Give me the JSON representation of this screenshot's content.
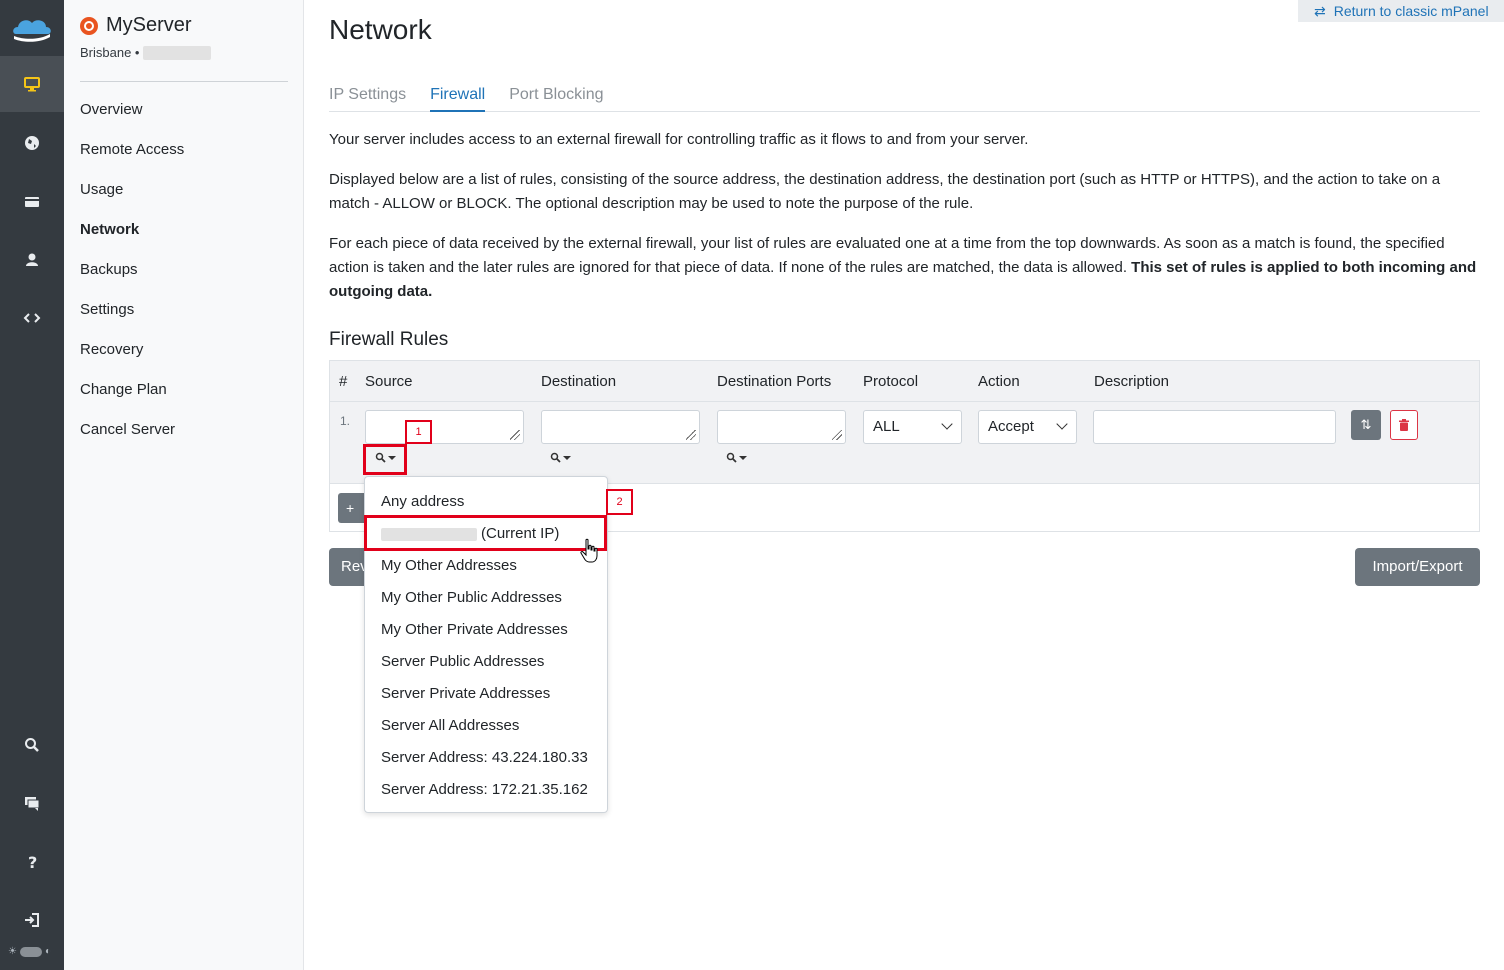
{
  "app": {
    "server_name": "MyServer",
    "location": "Brisbane •",
    "return_link": "Return to classic mPanel"
  },
  "rail": {
    "icons": [
      "cloud-logo-icon",
      "monitor-icon",
      "globe-icon",
      "billing-card-icon",
      "user-icon",
      "code-icon",
      "search-icon",
      "chat-icon",
      "help-icon",
      "logout-icon",
      "theme-toggle-icon"
    ]
  },
  "sidebar": {
    "items": [
      {
        "label": "Overview"
      },
      {
        "label": "Remote Access"
      },
      {
        "label": "Usage"
      },
      {
        "label": "Network",
        "active": true
      },
      {
        "label": "Backups"
      },
      {
        "label": "Settings"
      },
      {
        "label": "Recovery"
      },
      {
        "label": "Change Plan"
      },
      {
        "label": "Cancel Server"
      }
    ]
  },
  "page": {
    "title": "Network",
    "tabs": [
      {
        "label": "IP Settings"
      },
      {
        "label": "Firewall",
        "active": true
      },
      {
        "label": "Port Blocking"
      }
    ],
    "para1": "Your server includes access to an external firewall for controlling traffic as it flows to and from your server.",
    "para2": "Displayed below are a list of rules, consisting of the source address, the destination address, the destination port (such as HTTP or HTTPS), and the action to take on a match - ALLOW or BLOCK. The optional description may be used to note the purpose of the rule.",
    "para3": "For each piece of data received by the external firewall, your list of rules are evaluated one at a time from the top downwards. As soon as a match is found, the specified action is taken and the later rules are ignored for that piece of data. If none of the rules are matched, the data is allowed. ",
    "para3_bold": "This set of rules is applied to both incoming and outgoing data."
  },
  "firewall": {
    "section_title": "Firewall Rules",
    "columns": [
      "#",
      "Source",
      "Destination",
      "Destination Ports",
      "Protocol",
      "Action",
      "Description"
    ],
    "rows": [
      {
        "num": "1.",
        "source": "",
        "destination": "",
        "ports": "",
        "protocol": "ALL",
        "action": "Accept",
        "description": ""
      }
    ],
    "new_button": "+ N",
    "review_button": "Rev",
    "import_button": "Import/Export"
  },
  "dropdown": {
    "items": [
      "Any address",
      "(Current IP)",
      "My Other Addresses",
      "My Other Public Addresses",
      "My Other Private Addresses",
      "Server Public Addresses",
      "Server Private Addresses",
      "Server All Addresses",
      "Server Address: 43.224.180.33",
      "Server Address: 172.21.35.162"
    ]
  },
  "annotations": {
    "step1": "1",
    "step2": "2",
    "color": "#e1001a"
  },
  "colors": {
    "rail_bg": "#343a40",
    "accent": "#1f73b7",
    "active_rail_icon": "#f5c518",
    "button_gray": "#6c757d",
    "danger": "#dc3545"
  }
}
